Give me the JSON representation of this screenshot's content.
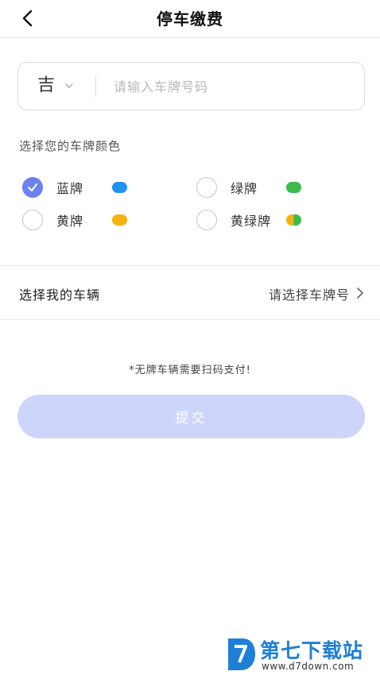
{
  "header": {
    "title": "停车缴费",
    "back_icon": "chevron-left-icon"
  },
  "plate": {
    "province": "吉",
    "province_icon": "chevron-down-icon",
    "placeholder": "请输入车牌号码",
    "value": ""
  },
  "plate_color": {
    "label": "选择您的车牌颜色",
    "options": [
      {
        "label": "蓝牌",
        "color": "#1f93ee",
        "selected": true
      },
      {
        "label": "绿牌",
        "color": "#3cbb4b",
        "selected": false
      },
      {
        "label": "黄牌",
        "color": "#f6b213",
        "selected": false
      },
      {
        "label": "黄绿牌",
        "color_left": "#f6b213",
        "color_right": "#3cbb4b",
        "selected": false
      }
    ]
  },
  "vehicle": {
    "label": "选择我的车辆",
    "value": "请选择车牌号",
    "icon": "chevron-right-icon"
  },
  "notice": "*无牌车辆需要扫码支付!",
  "submit_label": "提交",
  "colors": {
    "accent": "#6d82ef",
    "submit_disabled": "#cdd5fb"
  },
  "watermark": {
    "name": "第七下载站",
    "url": "www.d7down.com"
  }
}
